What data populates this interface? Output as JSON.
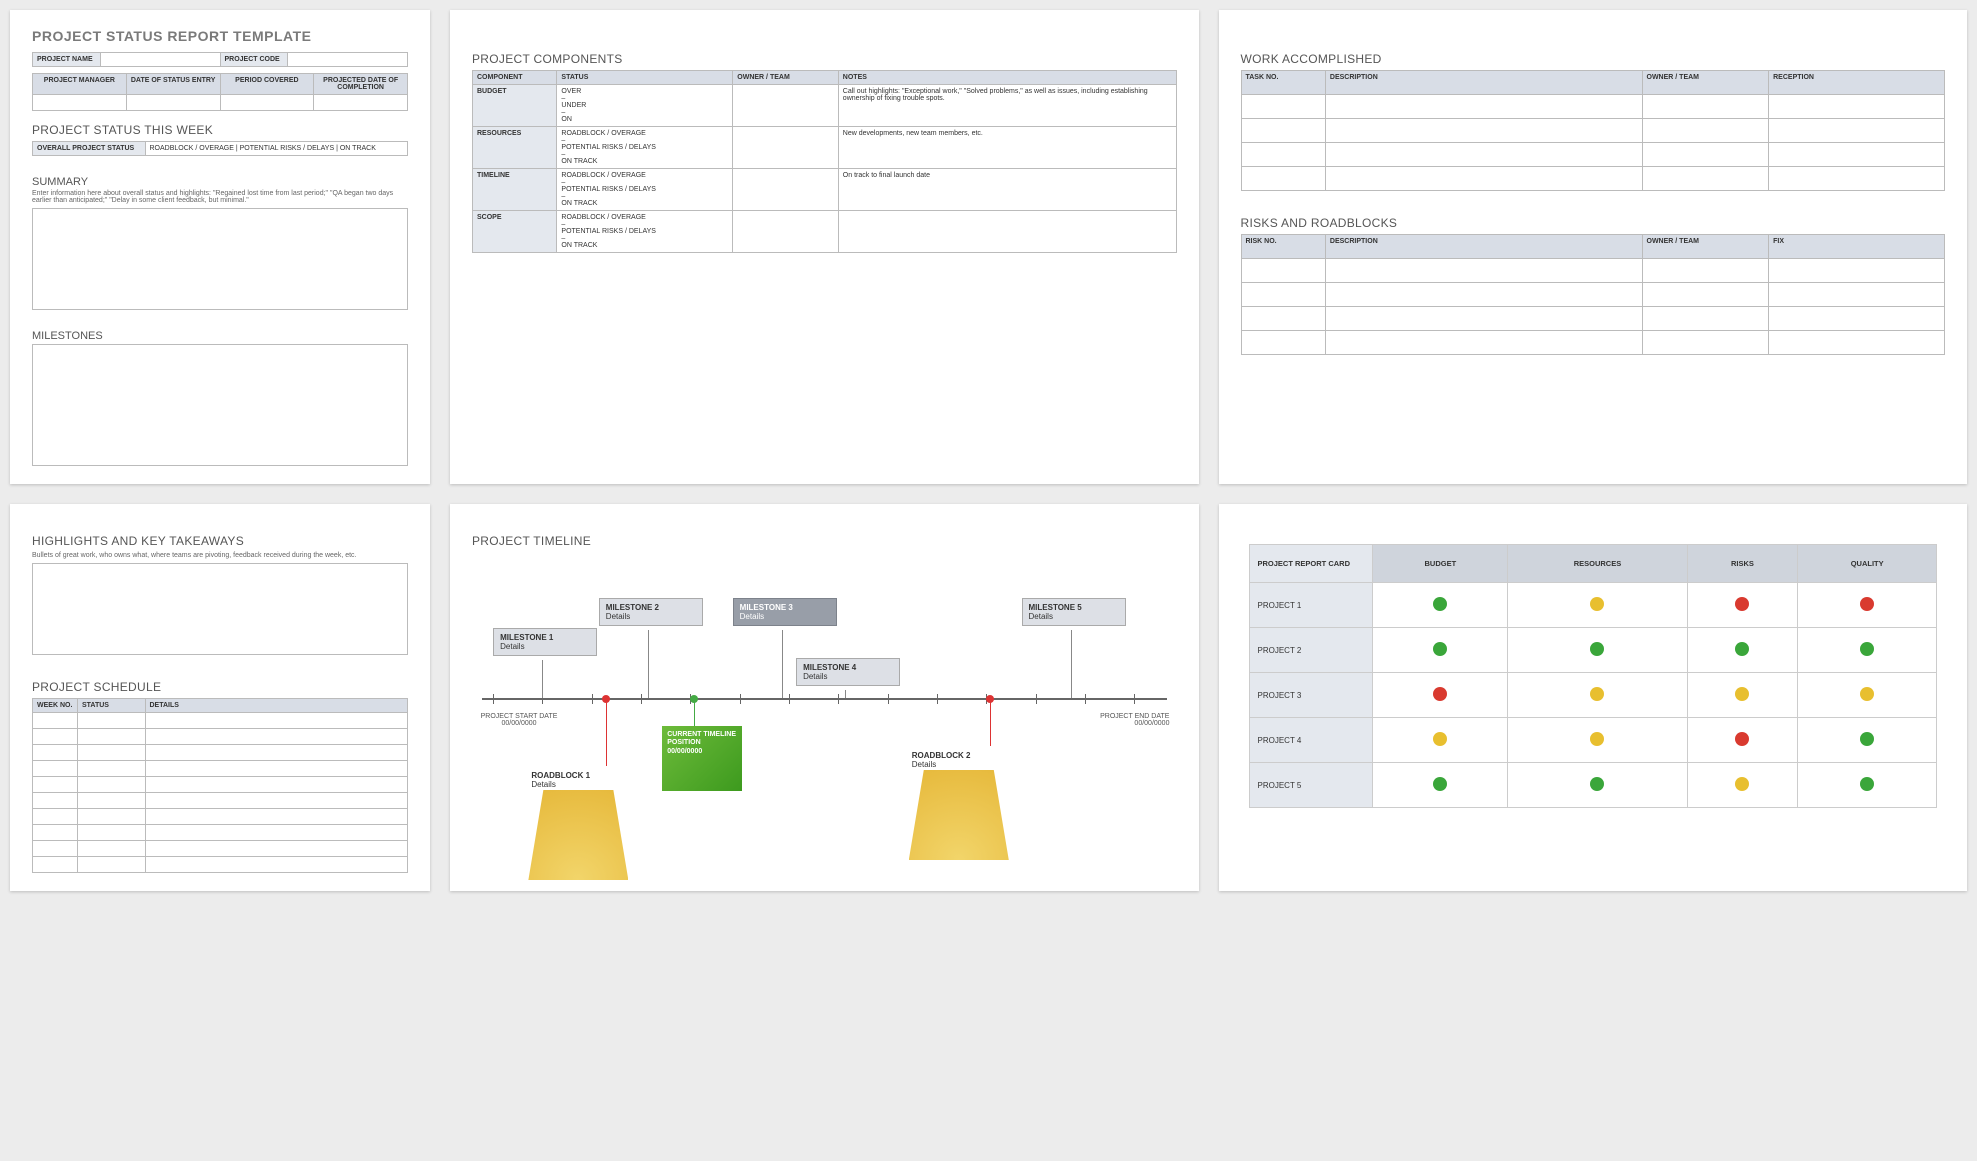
{
  "p1": {
    "title": "PROJECT STATUS REPORT TEMPLATE",
    "fields": {
      "name": "PROJECT NAME",
      "code": "PROJECT CODE",
      "manager": "PROJECT MANAGER",
      "entry": "DATE OF STATUS ENTRY",
      "period": "PERIOD COVERED",
      "completion": "PROJECTED DATE OF COMPLETION"
    },
    "status_title": "PROJECT STATUS THIS WEEK",
    "overall": "OVERALL PROJECT STATUS",
    "legend": "ROADBLOCK / OVERAGE    |    POTENTIAL RISKS / DELAYS    |    ON TRACK",
    "summary_title": "SUMMARY",
    "summary_hint": "Enter information here about overall status and highlights: \"Regained lost time from last period;\" \"QA began two days earlier than anticipated;\" \"Delay in some client feedback, but minimal.\"",
    "milestones_title": "MILESTONES"
  },
  "p2": {
    "title": "PROJECT COMPONENTS",
    "head": {
      "c": "COMPONENT",
      "s": "STATUS",
      "o": "OWNER / TEAM",
      "n": "NOTES"
    },
    "rows": [
      {
        "c": "BUDGET",
        "s": "OVER\n–\nUNDER\n–\nON",
        "n": "Call out highlights:  \"Exceptional work,\"  \"Solved problems,\" as well as issues, including establishing ownership of fixing trouble spots."
      },
      {
        "c": "RESOURCES",
        "s": "ROADBLOCK / OVERAGE\n–\nPOTENTIAL RISKS / DELAYS\n–\nON TRACK",
        "n": "New developments, new team members, etc."
      },
      {
        "c": "TIMELINE",
        "s": "ROADBLOCK / OVERAGE\n–\nPOTENTIAL RISKS / DELAYS\n–\nON TRACK",
        "n": "On track to final launch date"
      },
      {
        "c": "SCOPE",
        "s": "ROADBLOCK / OVERAGE\n–\nPOTENTIAL RISKS / DELAYS\n–\nON TRACK",
        "n": ""
      }
    ]
  },
  "p3": {
    "wa_title": "WORK ACCOMPLISHED",
    "wa_head": {
      "t": "TASK NO.",
      "d": "DESCRIPTION",
      "o": "OWNER / TEAM",
      "r": "RECEPTION"
    },
    "rr_title": "RISKS AND ROADBLOCKS",
    "rr_head": {
      "t": "RISK NO.",
      "d": "DESCRIPTION",
      "o": "OWNER / TEAM",
      "f": "FIX"
    }
  },
  "p4": {
    "title": "HIGHLIGHTS AND KEY TAKEAWAYS",
    "hint": "Bullets of great work, who owns what, where teams are pivoting, feedback received during the week, etc.",
    "sched_title": "PROJECT SCHEDULE",
    "sched_head": {
      "w": "WEEK NO.",
      "s": "STATUS",
      "d": "DETAILS"
    }
  },
  "p5": {
    "title": "PROJECT TIMELINE",
    "start": {
      "l": "PROJECT START DATE",
      "d": "00/00/0000"
    },
    "end": {
      "l": "PROJECT END DATE",
      "d": "00/00/0000"
    },
    "current": "CURRENT TIMELINE POSITION 00/00/0000",
    "ms": [
      {
        "t": "MILESTONE 1",
        "d": "Details"
      },
      {
        "t": "MILESTONE 2",
        "d": "Details"
      },
      {
        "t": "MILESTONE 3",
        "d": "Details"
      },
      {
        "t": "MILESTONE 4",
        "d": "Details"
      },
      {
        "t": "MILESTONE 5",
        "d": "Details"
      }
    ],
    "rb": [
      {
        "t": "ROADBLOCK 1",
        "d": "Details"
      },
      {
        "t": "ROADBLOCK 2",
        "d": "Details"
      }
    ]
  },
  "p6": {
    "head": {
      "p": "PROJECT REPORT CARD",
      "b": "BUDGET",
      "r": "RESOURCES",
      "k": "RISKS",
      "q": "QUALITY"
    },
    "rows": [
      {
        "n": "PROJECT 1",
        "b": "g",
        "r": "y",
        "k": "r",
        "q": "r"
      },
      {
        "n": "PROJECT 2",
        "b": "g",
        "r": "g",
        "k": "g",
        "q": "g"
      },
      {
        "n": "PROJECT 3",
        "b": "r",
        "r": "y",
        "k": "y",
        "q": "y"
      },
      {
        "n": "PROJECT 4",
        "b": "y",
        "r": "y",
        "k": "r",
        "q": "g"
      },
      {
        "n": "PROJECT 5",
        "b": "g",
        "r": "g",
        "k": "y",
        "q": "g"
      }
    ]
  }
}
